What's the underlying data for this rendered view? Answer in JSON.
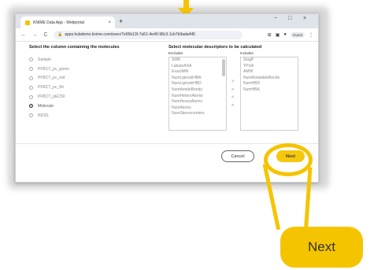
{
  "browser": {
    "tab_title": "KNIME Data App - Webportal",
    "tab_close": "×",
    "new_tab": "+",
    "url": "apps.hubdemo.knime.com/exec/7e55b13f-7a51-4e40-98c3-1cb7b9ada445",
    "profile": "Guest",
    "window_controls": [
      "−",
      "□",
      "×"
    ],
    "nav": [
      "←",
      "→",
      "C"
    ]
  },
  "app": {
    "left_heading": "Select the column containing the molecules",
    "columns": [
      {
        "label": "Sample",
        "selected": false
      },
      {
        "label": "PFBCT_pc_green",
        "selected": false
      },
      {
        "label": "PFBCT_pc_red",
        "selected": false
      },
      {
        "label": "PFBCT_pc_frit",
        "selected": false
      },
      {
        "label": "PFBCT_pEC50",
        "selected": false
      },
      {
        "label": "Molecule",
        "selected": true
      },
      {
        "label": "RESS",
        "selected": false
      }
    ],
    "right_heading": "Select molecular descriptors to be calculated",
    "excludes_label": "Excludes",
    "includes_label": "Includes",
    "excludes": [
      "SMR",
      "LabuteASA",
      "ExactMW",
      "NumLipinskiHBA",
      "NumLipinskiHBD",
      "NumAmideBonds",
      "NumHeteroAtoms",
      "NumHeavyAtoms",
      "NumAtoms",
      "NumStereocenters"
    ],
    "includes": [
      "SlogP",
      "TPSA",
      "AMW",
      "NumRotatableBonds",
      "NumHBD",
      "NumHBA"
    ],
    "move_buttons": [
      ">",
      "»",
      "<",
      "«"
    ],
    "cancel_label": "Cancel",
    "next_label": "Next"
  },
  "callout": {
    "label": "Next",
    "color": "#f5c400"
  }
}
